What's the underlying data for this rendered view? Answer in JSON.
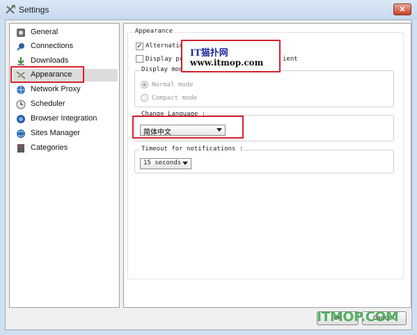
{
  "window": {
    "title": "Settings",
    "close_label": "✕"
  },
  "sidebar": {
    "items": [
      {
        "label": "General",
        "icon": "gear-icon"
      },
      {
        "label": "Connections",
        "icon": "connections-icon"
      },
      {
        "label": "Downloads",
        "icon": "download-icon"
      },
      {
        "label": "Appearance",
        "icon": "appearance-icon"
      },
      {
        "label": "Network Proxy",
        "icon": "globe-icon"
      },
      {
        "label": "Scheduler",
        "icon": "clock-icon"
      },
      {
        "label": "Browser Integration",
        "icon": "browser-icon"
      },
      {
        "label": "Sites Manager",
        "icon": "sites-icon"
      },
      {
        "label": "Categories",
        "icon": "categories-icon"
      }
    ],
    "selected": "Appearance"
  },
  "appearance": {
    "section_title": "Appearance",
    "alternating_label": "Alternatin",
    "alternating_checked": true,
    "display_label_left": "Display pr",
    "display_label_right": "ient",
    "display_checked": false,
    "display_mode": {
      "title": "Display mode",
      "options": [
        "Normal mode",
        "Compact mode"
      ],
      "selected": "Normal mode"
    },
    "change_language": {
      "title": "Change Language :",
      "selected": "简体中文"
    },
    "timeout": {
      "title": "Timeout for notifications :",
      "selected": "15 seconds"
    }
  },
  "footer": {
    "ok_label": "OK",
    "cancel_label": "Cancel"
  },
  "watermark": {
    "line1": "IT猫扑网",
    "line2": "www.itmop.com",
    "bottom": "ITMOP.COM"
  },
  "colors": {
    "highlight_red": "#d8202c",
    "watermark_green": "#3aa64a",
    "titlebar_blue": "#cfe0f1"
  }
}
